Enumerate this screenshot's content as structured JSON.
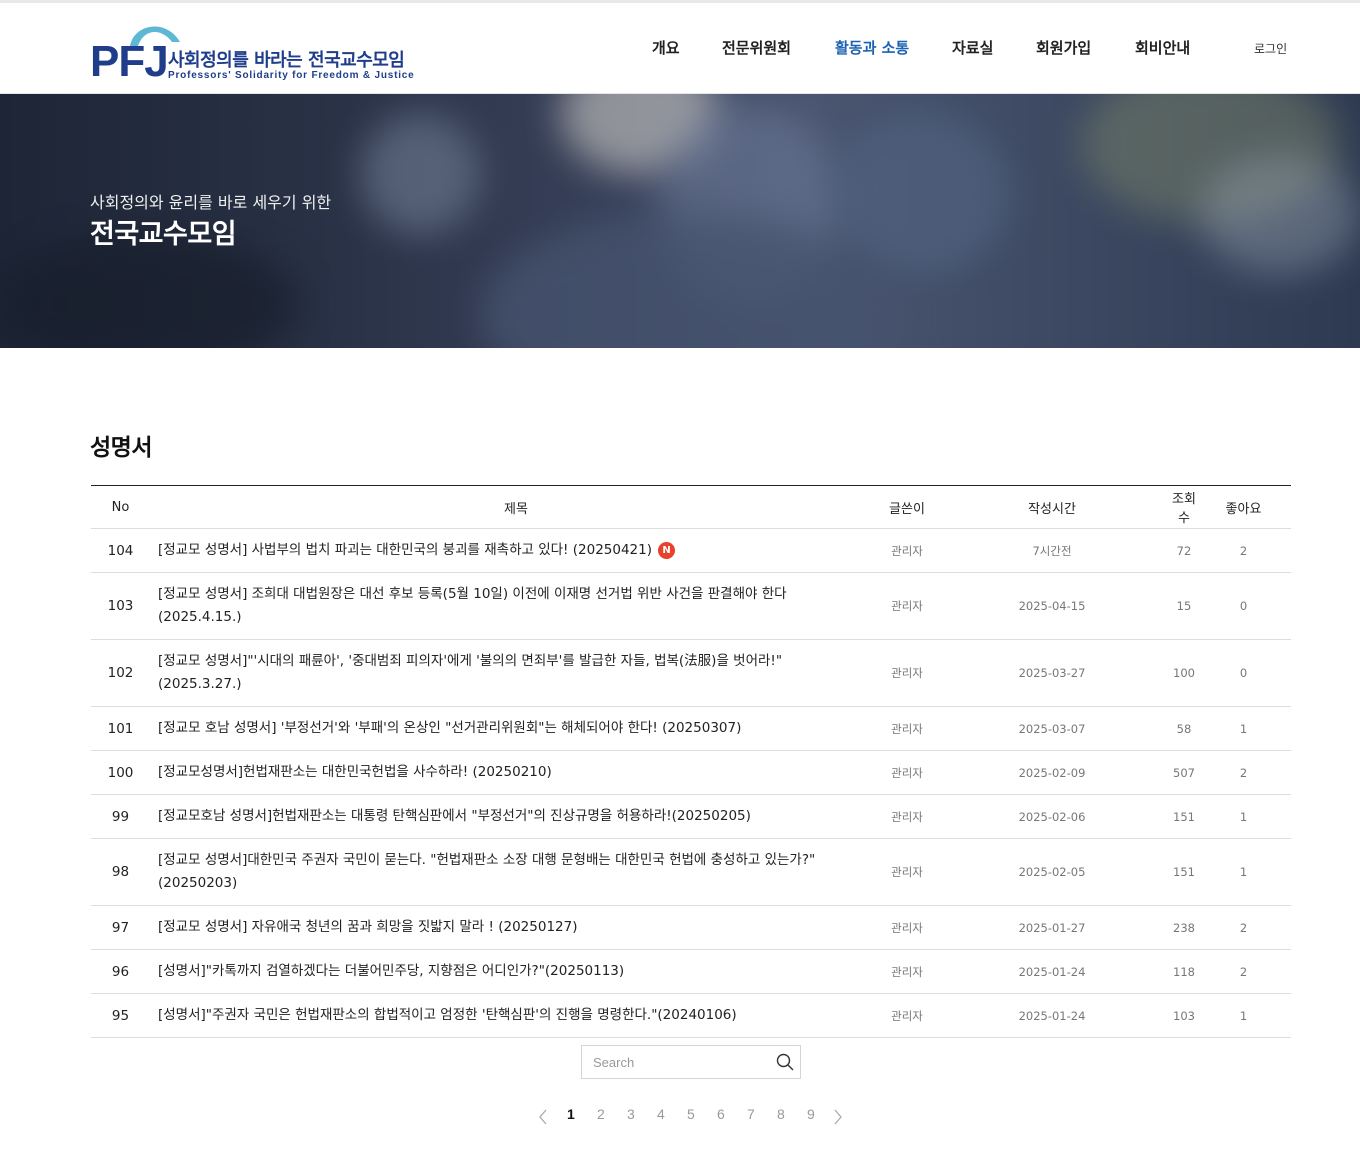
{
  "brand": {
    "logo_text": "PFJ",
    "name_kr": "사회정의를 바라는 전국교수모임",
    "name_en": "Professors' Solidarity for Freedom & Justice",
    "color": "#1f3d8a"
  },
  "nav": {
    "items": [
      {
        "label": "개요",
        "active": false
      },
      {
        "label": "전문위원회",
        "active": false
      },
      {
        "label": "활동과 소통",
        "active": true
      },
      {
        "label": "자료실",
        "active": false
      },
      {
        "label": "회원가입",
        "active": false
      },
      {
        "label": "회비안내",
        "active": false
      }
    ],
    "login_label": "로그인",
    "active_color": "#1c62b4"
  },
  "hero": {
    "subtitle": "사회정의와 윤리를 바로 세우기 위한",
    "title": "전국교수모임"
  },
  "board": {
    "title": "성명서",
    "columns": [
      "No",
      "제목",
      "글쓴이",
      "작성시간",
      "조회수",
      "좋아요"
    ],
    "rows": [
      {
        "no": "104",
        "subject": "[정교모 성명서] 사법부의 법치 파괴는 대한민국의 붕괴를 재촉하고 있다! (20250421)",
        "is_new": true,
        "new_badge": "N",
        "author": "관리자",
        "date": "7시간전",
        "views": "72",
        "likes": "2"
      },
      {
        "no": "103",
        "subject": "[정교모 성명서] 조희대 대법원장은 대선 후보 등록(5월 10일) 이전에 이재명 선거법 위반 사건을 판결해야 한다 (2025.4.15.)",
        "is_new": false,
        "author": "관리자",
        "date": "2025-04-15",
        "views": "15",
        "likes": "0"
      },
      {
        "no": "102",
        "subject": "[정교모 성명서]\"'시대의 패륜아', '중대범죄 피의자'에게 '불의의 면죄부'를 발급한 자들, 법복(法服)을 벗어라!\" (2025.3.27.)",
        "is_new": false,
        "author": "관리자",
        "date": "2025-03-27",
        "views": "100",
        "likes": "0"
      },
      {
        "no": "101",
        "subject": "[정교모 호남 성명서] '부정선거'와 '부패'의 온상인 \"선거관리위원회\"는 해체되어야 한다! (20250307)",
        "is_new": false,
        "author": "관리자",
        "date": "2025-03-07",
        "views": "58",
        "likes": "1"
      },
      {
        "no": "100",
        "subject": "[정교모성명서]헌법재판소는 대한민국헌법을 사수하라! (20250210)",
        "is_new": false,
        "author": "관리자",
        "date": "2025-02-09",
        "views": "507",
        "likes": "2"
      },
      {
        "no": "99",
        "subject": "[정교모호남 성명서]헌법재판소는 대통령 탄핵심판에서 \"부정선거\"의 진상규명을 허용하라!(20250205)",
        "is_new": false,
        "author": "관리자",
        "date": "2025-02-06",
        "views": "151",
        "likes": "1"
      },
      {
        "no": "98",
        "subject": "[정교모 성명서]대한민국 주권자 국민이 묻는다. \"헌법재판소 소장 대행 문형배는 대한민국 헌법에 충성하고 있는가?\" (20250203)",
        "is_new": false,
        "author": "관리자",
        "date": "2025-02-05",
        "views": "151",
        "likes": "1"
      },
      {
        "no": "97",
        "subject": "[정교모 성명서] 자유애국 청년의 꿈과 희망을 짓밟지 말라 ! (20250127)",
        "is_new": false,
        "author": "관리자",
        "date": "2025-01-27",
        "views": "238",
        "likes": "2"
      },
      {
        "no": "96",
        "subject": "[성명서]\"카톡까지 검열하겠다는 더불어민주당, 지향점은 어디인가?\"(20250113)",
        "is_new": false,
        "author": "관리자",
        "date": "2025-01-24",
        "views": "118",
        "likes": "2"
      },
      {
        "no": "95",
        "subject": "[성명서]\"주권자 국민은 헌법재판소의 합법적이고 엄정한 '탄핵심판'의 진행을 명령한다.\"(20240106)",
        "is_new": false,
        "author": "관리자",
        "date": "2025-01-24",
        "views": "103",
        "likes": "1"
      }
    ]
  },
  "search": {
    "placeholder": "Search",
    "icon": "search-icon"
  },
  "pagination": {
    "prev_icon": "chevron-left-icon",
    "next_icon": "chevron-right-icon",
    "pages": [
      "1",
      "2",
      "3",
      "4",
      "5",
      "6",
      "7",
      "8",
      "9"
    ],
    "current": "1"
  }
}
